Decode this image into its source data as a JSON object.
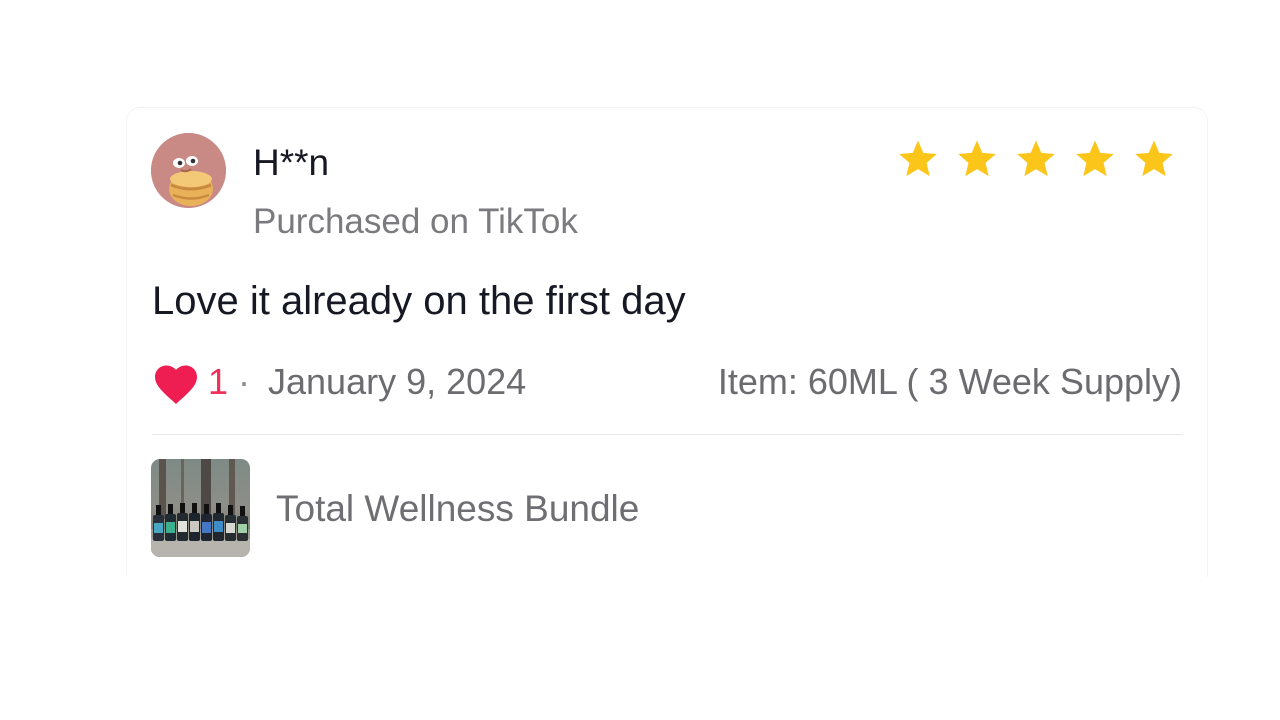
{
  "review": {
    "username": "H**n",
    "source": "Purchased on TikTok",
    "rating": 5,
    "rating_max": 5,
    "star_color": "#FCC51A",
    "text": "Love it already on the first day",
    "likes": "1",
    "separator": "·",
    "date": "January 9, 2024",
    "item": "Item: 60ML ( 3 Week Supply)",
    "heart_color": "#EE1D52"
  },
  "product": {
    "name": "Total Wellness Bundle"
  }
}
